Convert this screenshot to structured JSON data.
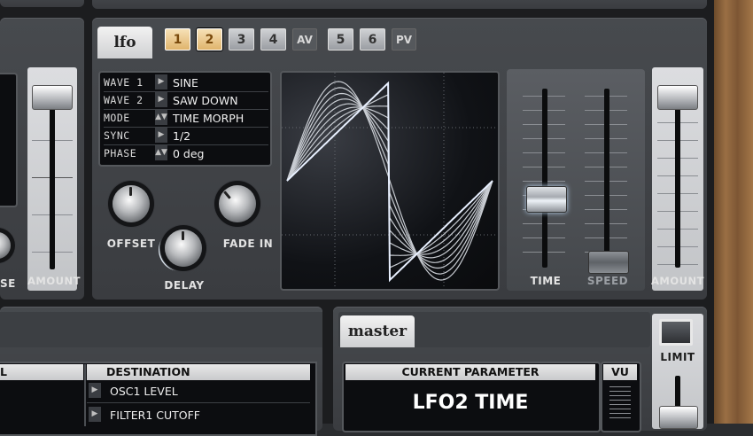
{
  "lfo": {
    "tab_label": "lfo",
    "buttons": [
      "1",
      "2",
      "3",
      "4",
      "AV",
      "5",
      "6",
      "PV"
    ],
    "wave1_label": "WAVE 1",
    "wave1_value": "SINE",
    "wave2_label": "WAVE 2",
    "wave2_value": "SAW DOWN",
    "mode_label": "MODE",
    "mode_value": "TIME MORPH",
    "sync_label": "SYNC",
    "sync_value": "1/2",
    "phase_label": "PHASE",
    "phase_value": "0 deg",
    "offset_label": "OFFSET",
    "delay_label": "DELAY",
    "fadein_label": "FADE IN",
    "time_label": "TIME",
    "speed_label": "SPEED",
    "amount_label": "AMOUNT",
    "left_amount_label": "AMOUNT",
    "left_partial_label": "SE"
  },
  "master": {
    "tab_label": "master",
    "limit_label": "LIMIT",
    "current_param_header": "CURRENT PARAMETER",
    "vu_header": "VU",
    "current_param_value": "LFO2 TIME"
  },
  "mod_matrix": {
    "left_header": "L",
    "destination_header": "DESTINATION",
    "rows": [
      "OSC1 LEVEL",
      "FILTER1 CUTOFF"
    ]
  },
  "colors": {
    "active_button": "#e0b46c",
    "lcd": "#0c0d10",
    "panel": "#404347"
  }
}
